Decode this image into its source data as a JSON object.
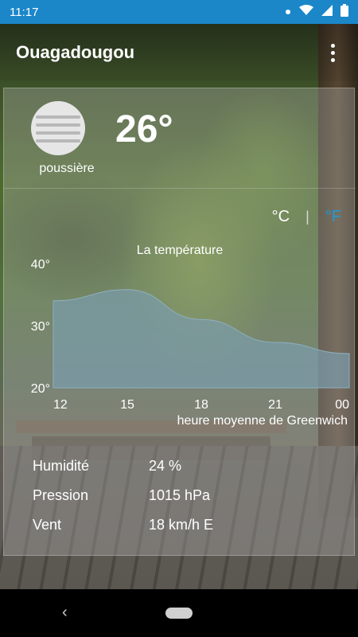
{
  "status_bar": {
    "time": "11:17"
  },
  "header": {
    "city": "Ouagadougou"
  },
  "current": {
    "condition_icon": "dust-icon",
    "condition": "poussière",
    "temperature": "26°"
  },
  "units": {
    "celsius": "°C",
    "separator": "|",
    "fahrenheit": "°F",
    "active_color": "#ffffff",
    "inactive_color": "#1e9ad6"
  },
  "chart_data": {
    "type": "area",
    "title": "La température",
    "xlabel": "heure moyenne de Greenwich",
    "ylabel": "",
    "x": [
      12,
      15,
      18,
      21,
      24
    ],
    "x_tick_labels": [
      "12",
      "15",
      "18",
      "21",
      "00"
    ],
    "y": [
      34,
      35.8,
      31,
      27.3,
      25.5
    ],
    "y_ticks": [
      "40°",
      "30°",
      "20°"
    ],
    "ylim": [
      20,
      40
    ],
    "fill_color": "#7a9cad"
  },
  "details": [
    {
      "label": "Humidité",
      "value": "24 %"
    },
    {
      "label": "Pression",
      "value": "1015 hPa"
    },
    {
      "label": "Vent",
      "value": "18 km/h E"
    }
  ],
  "colors": {
    "status_bar": "#1b87c9",
    "accent": "#1e9ad6"
  }
}
